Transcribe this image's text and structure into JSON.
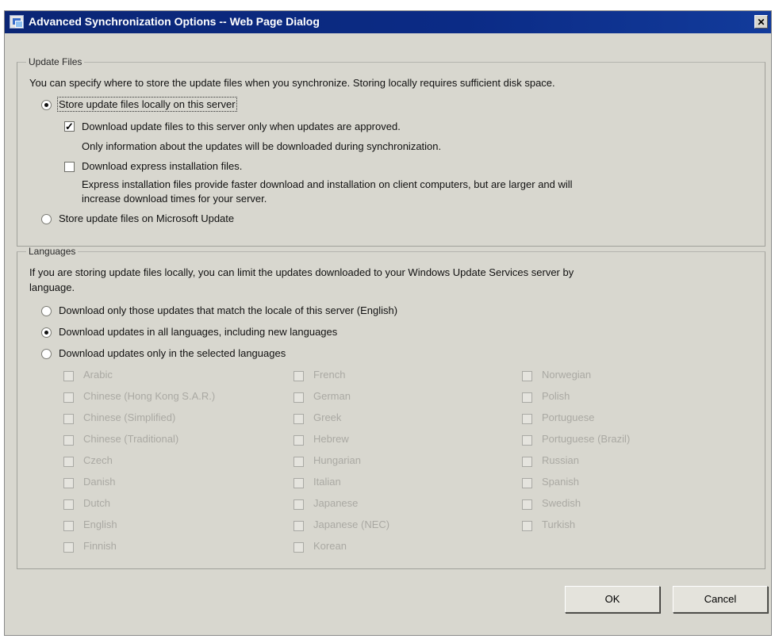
{
  "window": {
    "title": "Advanced Synchronization Options -- Web Page Dialog",
    "close_glyph": "✕",
    "title_icon": "web-page-dialog-icon"
  },
  "update_files": {
    "legend": "Update Files",
    "description": "You can specify where to store the update files when you synchronize. Storing locally requires sufficient disk space.",
    "store_locally": {
      "label": "Store update files locally on this server",
      "selected": true
    },
    "download_when_approved": {
      "label": "Download update files to this server only when updates are approved.",
      "checked": true,
      "note": "Only information about the updates will be downloaded during synchronization."
    },
    "express_files": {
      "label": "Download express installation files.",
      "checked": false,
      "note_line1": "Express installation files provide faster download and installation on client computers, but are larger and will",
      "note_line2": "increase download times for your server."
    },
    "store_microsoft": {
      "label": "Store update files on Microsoft Update",
      "selected": false
    }
  },
  "languages": {
    "legend": "Languages",
    "description_line1": "If you are storing update files locally, you can limit the updates downloaded to your Windows Update Services server by",
    "description_line2": "language.",
    "option_locale": {
      "label": "Download only those updates that match the locale of this server (English)",
      "selected": false
    },
    "option_all": {
      "label": "Download updates in all languages, including new languages",
      "selected": true
    },
    "option_selected": {
      "label": "Download updates only in the selected languages",
      "selected": false
    },
    "columns": [
      [
        "Arabic",
        "Chinese (Hong Kong S.A.R.)",
        "Chinese (Simplified)",
        "Chinese (Traditional)",
        "Czech",
        "Danish",
        "Dutch",
        "English",
        "Finnish"
      ],
      [
        "French",
        "German",
        "Greek",
        "Hebrew",
        "Hungarian",
        "Italian",
        "Japanese",
        "Japanese (NEC)",
        "Korean"
      ],
      [
        "Norwegian",
        "Polish",
        "Portuguese",
        "Portuguese (Brazil)",
        "Russian",
        "Spanish",
        "Swedish",
        "Turkish"
      ]
    ]
  },
  "buttons": {
    "ok": "OK",
    "cancel": "Cancel"
  }
}
